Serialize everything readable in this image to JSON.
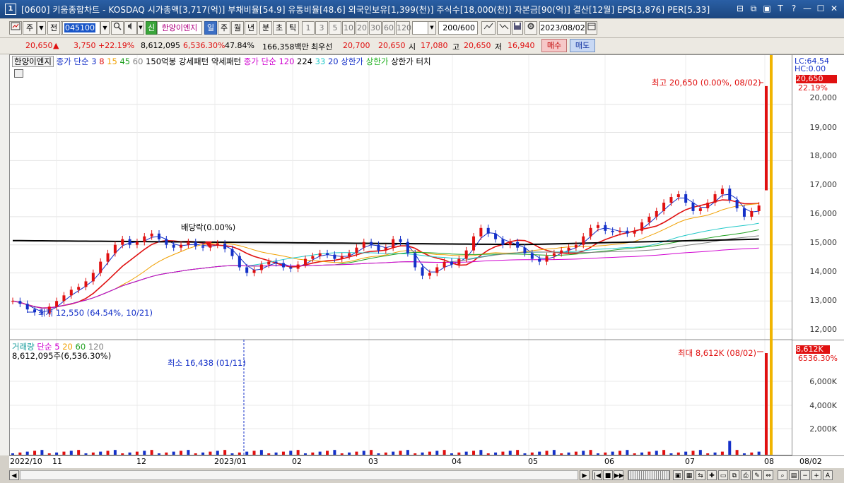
{
  "window": {
    "number": "1",
    "title": "[0600] 키움종합차트 - KOSDAQ 시가총액[3,717(억)] 부채비율[54.9] 유통비율[48.6] 외국인보유[1,399(천)] 주식수[18,000(천)] 자본금[90(억)] 결산[12월] EPS[3,876] PER[5.33]",
    "buttons": [
      "⊟",
      "⧉",
      "▣",
      "T",
      "?",
      "—",
      "☐",
      "✕"
    ]
  },
  "toolbar": {
    "period_label": "주",
    "prev_label": "전",
    "code": "045100",
    "new_badge": "신",
    "stock_name": "한양이엔지",
    "timeframes": [
      "일",
      "주",
      "월",
      "년",
      "분",
      "초",
      "틱"
    ],
    "selected_timeframe": "일",
    "minutes": [
      "1",
      "3",
      "5",
      "10",
      "20",
      "30",
      "60",
      "120"
    ],
    "count": "200/600",
    "date": "2023/08/02"
  },
  "quote": {
    "price": "20,650",
    "arrow": "▲",
    "change": "3,750",
    "change_pct": "+22.19%",
    "volume": "8,612,095",
    "volume_ratio": "6,536.30%",
    "turnover": "47.84%",
    "amount": "166,358백만",
    "best_label": "최우선",
    "ask": "20,700",
    "bid": "20,650",
    "open_label": "시",
    "open": "17,080",
    "high_label": "고",
    "high": "20,650",
    "low_label": "저",
    "low": "16,940",
    "buy_label": "매수",
    "sell_label": "매도"
  },
  "legend_price": {
    "name": "한양이엔지",
    "ma_label": "종가 단순",
    "ma_periods": [
      "3",
      "8",
      "15",
      "45",
      "60"
    ],
    "pattern_150": "150억봉 강세패턴",
    "weak_pattern": "약세패턴",
    "ma2_label": "종가 단순",
    "ma2_periods": [
      "120",
      "224",
      "33",
      "20"
    ],
    "upper_limit": "상한가",
    "upper_limit2": "상한가",
    "upper_touch": "상한가 터치"
  },
  "legend_volume": {
    "label": "거래량",
    "ma_label": "단순",
    "periods": [
      "5",
      "20",
      "60",
      "120"
    ],
    "value": "8,612,095주(6,536.30%)"
  },
  "annotations": {
    "max_price": "최고 20,650 (0.00%, 08/02)",
    "min_price": "최저 12,550 (64.54%, 10/21)",
    "dividend": "배당락(0.00%)",
    "max_volume": "최대 8,612K (08/02)",
    "min_volume": "최소 16,438 (01/11)"
  },
  "right_axis": {
    "lc": "LC:64.54",
    "hc": "HC:0.00",
    "price_tag": "20,650",
    "pct_tag": "22.19%",
    "vol_tag": "8,612K",
    "vol_pct_tag": "6536.30%",
    "price_ticks": [
      "20,000",
      "19,000",
      "18,000",
      "17,000",
      "16,000",
      "15,000",
      "14,000",
      "13,000",
      "12,000"
    ],
    "volume_ticks": [
      "6,000K",
      "4,000K",
      "2,000K"
    ]
  },
  "x_axis": {
    "labels": [
      "2022/10",
      "11",
      "12",
      "2023/01",
      "02",
      "03",
      "04",
      "05",
      "06",
      "07",
      "08"
    ],
    "right_label": "08/02"
  },
  "colors": {
    "up": "#e01010",
    "down": "#1430c8",
    "ma3": "#1430c8",
    "ma8": "#e01010",
    "ma15": "#f0a000",
    "ma45": "#20a020",
    "ma60": "#808080",
    "ma120": "#d000d0",
    "ma224": "#000000",
    "ma33": "#20c8c8",
    "ma20": "#1430c8",
    "current_line": "#f0b400"
  },
  "chart_data": {
    "type": "candlestick",
    "ylim": [
      11700,
      21200
    ],
    "volume_ylim": [
      0,
      9000
    ],
    "price_series": [
      [
        0,
        13000
      ],
      [
        1,
        12900
      ],
      [
        2,
        12700
      ],
      [
        3,
        12600
      ],
      [
        4,
        12550
      ],
      [
        5,
        12800
      ],
      [
        6,
        13000
      ],
      [
        7,
        13200
      ],
      [
        8,
        13400
      ],
      [
        9,
        13500
      ],
      [
        10,
        13700
      ],
      [
        11,
        14000
      ],
      [
        12,
        14400
      ],
      [
        13,
        14700
      ],
      [
        14,
        15000
      ],
      [
        15,
        15200
      ],
      [
        16,
        15000
      ],
      [
        17,
        15100
      ],
      [
        18,
        15300
      ],
      [
        19,
        15400
      ],
      [
        20,
        15200
      ],
      [
        21,
        15000
      ],
      [
        22,
        14900
      ],
      [
        23,
        15000
      ],
      [
        24,
        15100
      ],
      [
        25,
        14950
      ],
      [
        26,
        14900
      ],
      [
        27,
        15000
      ],
      [
        28,
        15050
      ],
      [
        29,
        14850
      ],
      [
        30,
        14600
      ],
      [
        31,
        14200
      ],
      [
        32,
        14000
      ],
      [
        33,
        14100
      ],
      [
        34,
        14300
      ],
      [
        35,
        14400
      ],
      [
        36,
        14350
      ],
      [
        37,
        14200
      ],
      [
        38,
        14150
      ],
      [
        39,
        14300
      ],
      [
        40,
        14500
      ],
      [
        41,
        14600
      ],
      [
        42,
        14700
      ],
      [
        43,
        14650
      ],
      [
        44,
        14500
      ],
      [
        45,
        14600
      ],
      [
        46,
        14700
      ],
      [
        47,
        14900
      ],
      [
        48,
        15100
      ],
      [
        49,
        15000
      ],
      [
        50,
        14800
      ],
      [
        51,
        14900
      ],
      [
        52,
        15200
      ],
      [
        53,
        15100
      ],
      [
        54,
        14700
      ],
      [
        55,
        14200
      ],
      [
        56,
        13900
      ],
      [
        57,
        14000
      ],
      [
        58,
        14200
      ],
      [
        59,
        14400
      ],
      [
        60,
        14300
      ],
      [
        61,
        14500
      ],
      [
        62,
        14800
      ],
      [
        63,
        15300
      ],
      [
        64,
        15600
      ],
      [
        65,
        15400
      ],
      [
        66,
        15200
      ],
      [
        67,
        15000
      ],
      [
        68,
        15100
      ],
      [
        69,
        14900
      ],
      [
        70,
        14700
      ],
      [
        71,
        14500
      ],
      [
        72,
        14400
      ],
      [
        73,
        14600
      ],
      [
        74,
        14700
      ],
      [
        75,
        14800
      ],
      [
        76,
        14900
      ],
      [
        77,
        15000
      ],
      [
        78,
        15300
      ],
      [
        79,
        15600
      ],
      [
        80,
        15700
      ],
      [
        81,
        15500
      ],
      [
        82,
        15450
      ],
      [
        83,
        15500
      ],
      [
        84,
        15400
      ],
      [
        85,
        15500
      ],
      [
        86,
        15800
      ],
      [
        87,
        16000
      ],
      [
        88,
        16200
      ],
      [
        89,
        16500
      ],
      [
        90,
        16700
      ],
      [
        91,
        16800
      ],
      [
        92,
        16500
      ],
      [
        93,
        16200
      ],
      [
        94,
        16300
      ],
      [
        95,
        16500
      ],
      [
        96,
        16800
      ],
      [
        97,
        17000
      ],
      [
        98,
        16600
      ],
      [
        99,
        16300
      ],
      [
        100,
        16000
      ],
      [
        101,
        16200
      ],
      [
        102,
        16400
      ],
      [
        103,
        20650
      ]
    ],
    "volume_spike": 8612
  }
}
